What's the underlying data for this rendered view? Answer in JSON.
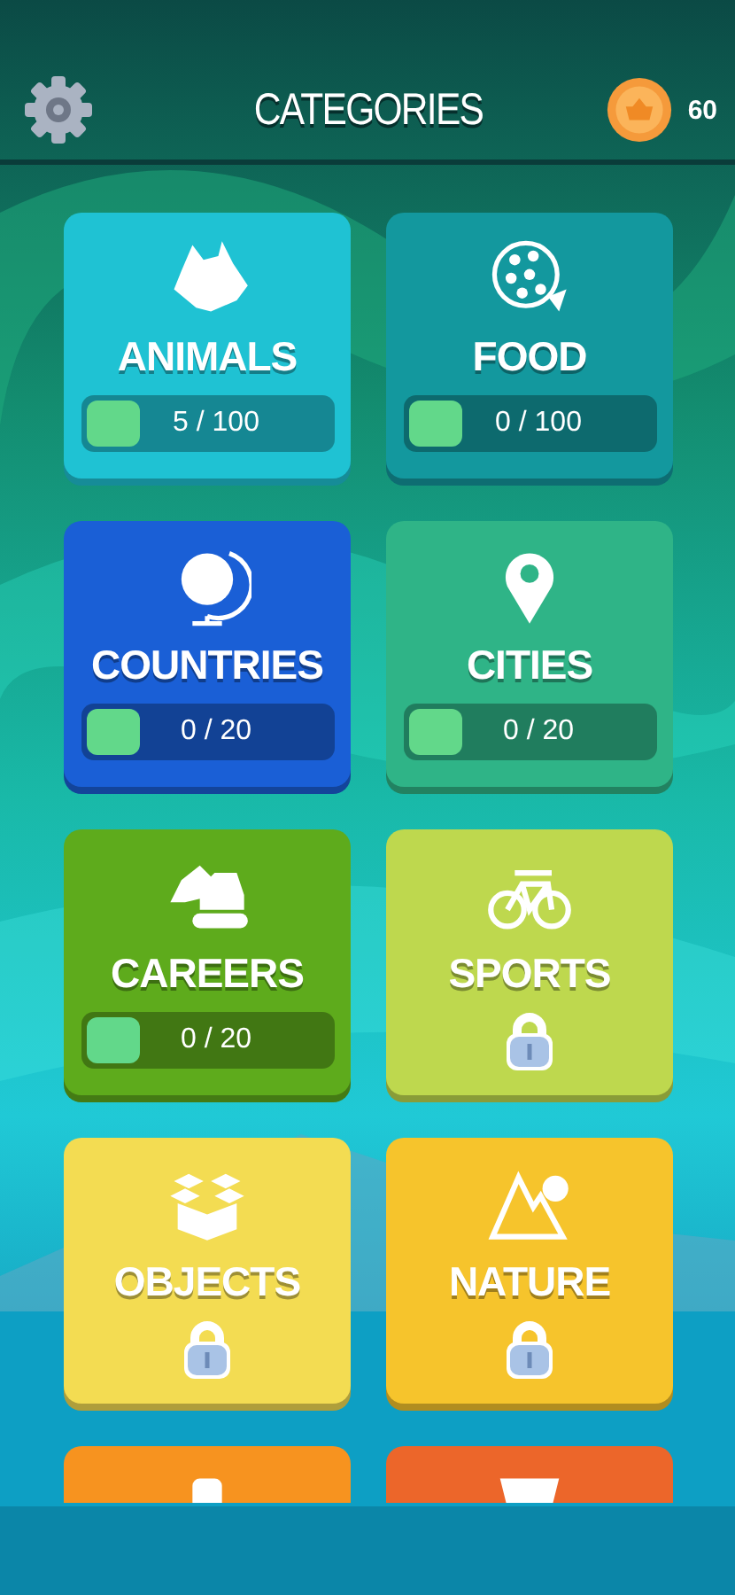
{
  "header": {
    "title": "CATEGORIES",
    "coins": "60"
  },
  "categories": [
    {
      "name": "ANIMALS",
      "color": "#1fc2d3",
      "locked": false,
      "progress": "5 / 100"
    },
    {
      "name": "FOOD",
      "color": "#13989e",
      "locked": false,
      "progress": "0 / 100"
    },
    {
      "name": "COUNTRIES",
      "color": "#1a5fd6",
      "locked": false,
      "progress": "0 / 20"
    },
    {
      "name": "CITIES",
      "color": "#2fb487",
      "locked": false,
      "progress": "0 / 20"
    },
    {
      "name": "CAREERS",
      "color": "#5eab1c",
      "locked": false,
      "progress": "0 / 20"
    },
    {
      "name": "SPORTS",
      "color": "#bed84e",
      "locked": true
    },
    {
      "name": "OBJECTS",
      "color": "#f3dc52",
      "locked": true
    },
    {
      "name": "NATURE",
      "color": "#f6c42c",
      "locked": true
    },
    {
      "color": "#f7931f"
    },
    {
      "color": "#ec662a"
    }
  ]
}
